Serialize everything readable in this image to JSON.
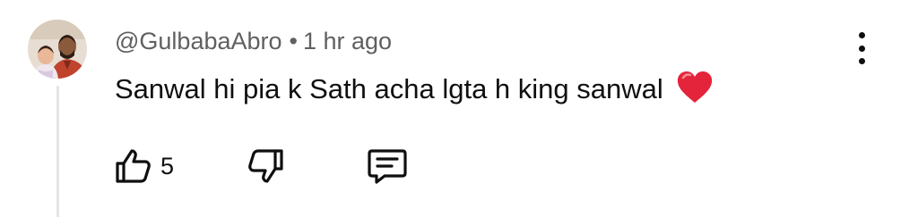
{
  "comment": {
    "author": "@GulbabaAbro",
    "separator": "•",
    "time": "1 hr ago",
    "text": "Sanwal hi pia k Sath acha lgta h king sanwal",
    "emoji_icon": "red-heart-icon"
  },
  "actions": {
    "like_icon": "thumbs-up-icon",
    "like_count": "5",
    "dislike_icon": "thumbs-down-icon",
    "reply_icon": "comment-reply-icon",
    "more_icon": "vertical-dots-icon"
  },
  "colors": {
    "text_primary": "#0f0f0f",
    "text_secondary": "#606060",
    "heart": "#e3243b",
    "thread_line": "#e5e5e5"
  }
}
